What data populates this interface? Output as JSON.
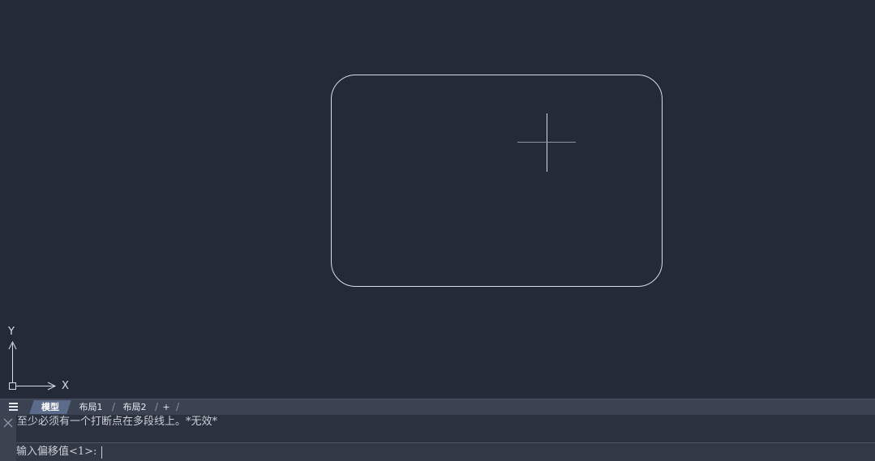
{
  "canvas": {
    "background": "#242a38",
    "line_color": "#d8dce4"
  },
  "ucs": {
    "x_label": "X",
    "y_label": "Y"
  },
  "layout_tabs": {
    "menu_icon": "hamburger-menu-icon",
    "tabs": [
      {
        "label": "模型",
        "active": true
      },
      {
        "label": "布局1",
        "active": false
      },
      {
        "label": "布局2",
        "active": false
      },
      {
        "label": "+",
        "active": false
      }
    ],
    "separator": "/"
  },
  "command_line": {
    "history": "至少必须有一个打断点在多段线上。*无效*",
    "prompt": "输入偏移值<1>:",
    "value": "",
    "close_icon": "close-icon"
  }
}
